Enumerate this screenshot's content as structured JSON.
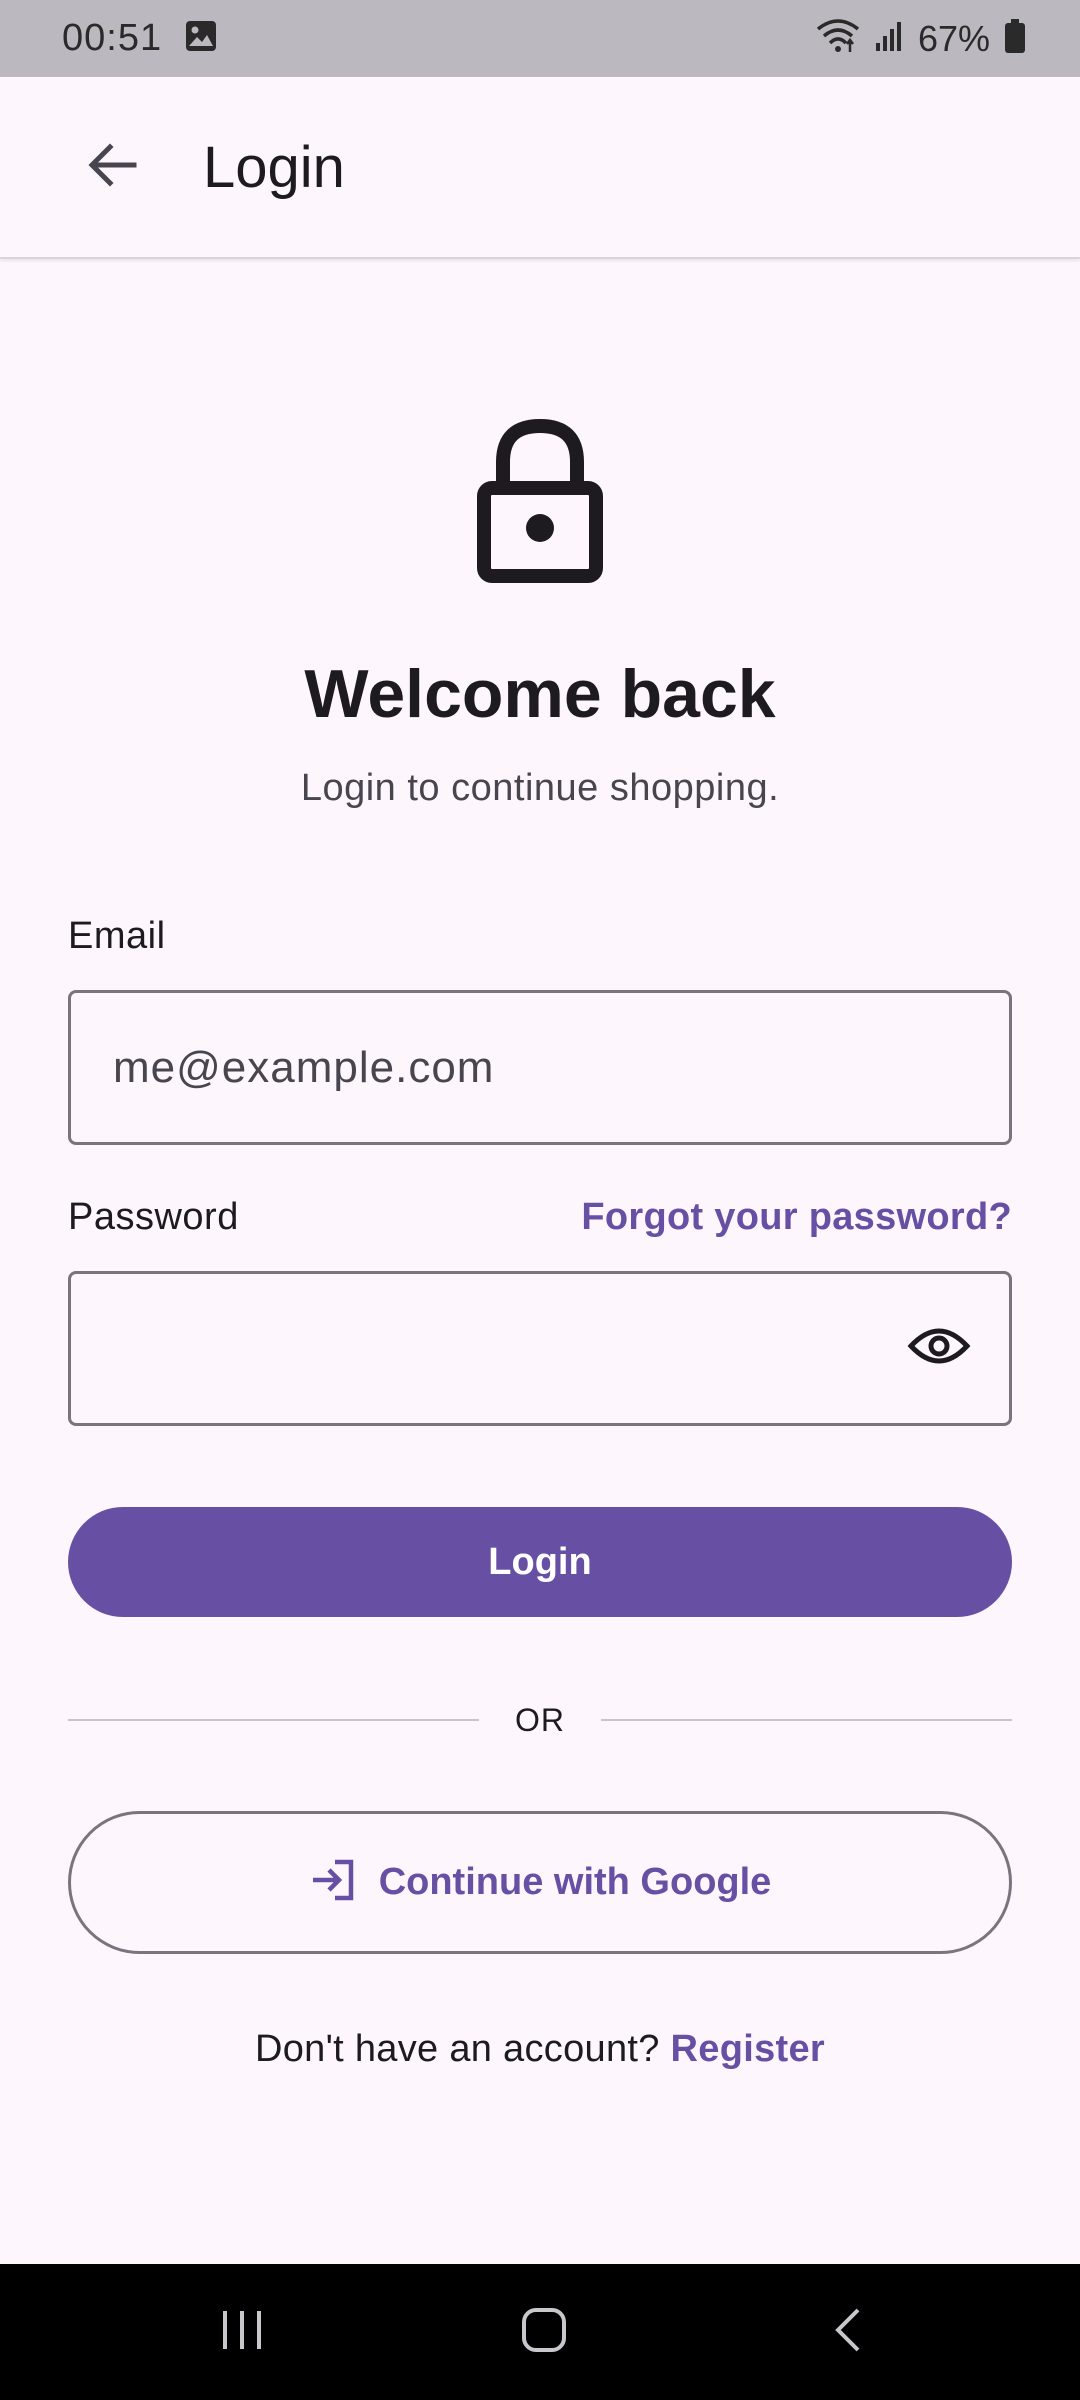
{
  "status_bar": {
    "time": "00:51",
    "battery": "67%"
  },
  "app_bar": {
    "title": "Login"
  },
  "hero": {
    "heading": "Welcome back",
    "subheading": "Login to continue shopping."
  },
  "form": {
    "email_label": "Email",
    "email_placeholder": "me@example.com",
    "email_value": "",
    "password_label": "Password",
    "password_value": "",
    "forgot_label": "Forgot your password?",
    "login_label": "Login",
    "divider_label": "OR",
    "google_label": "Continue with Google"
  },
  "footer": {
    "prompt": "Don't have an account? ",
    "register_label": "Register"
  },
  "colors": {
    "primary": "#6750a4",
    "background": "#fdf7fd",
    "outline": "#79747e",
    "status_bar": "#bcb8bf",
    "nav_bar": "#000000"
  },
  "icons": {
    "back": "arrow-left-icon",
    "lock": "lock-icon",
    "visibility": "eye-icon",
    "google_login": "login-arrow-icon",
    "gallery": "image-icon",
    "wifi": "wifi-icon",
    "signal": "signal-icon",
    "battery": "battery-icon",
    "nav_recents": "recents-icon",
    "nav_home": "home-icon",
    "nav_back": "nav-back-icon"
  }
}
